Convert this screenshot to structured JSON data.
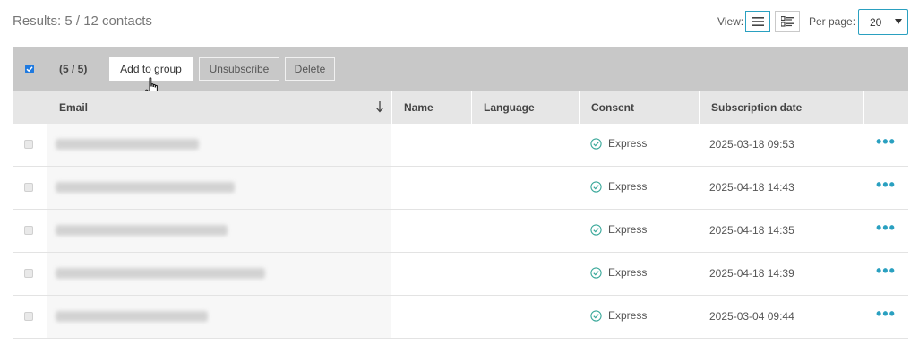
{
  "header": {
    "results_text": "Results: 5 / 12 contacts",
    "view_label": "View:",
    "per_page_label": "Per page:",
    "per_page_value": "20"
  },
  "bulk": {
    "selection_count": "(5 / 5)",
    "add_to_group_label": "Add to group",
    "unsubscribe_label": "Unsubscribe",
    "delete_label": "Delete"
  },
  "table": {
    "columns": [
      "Email",
      "Name",
      "Language",
      "Consent",
      "Subscription date"
    ],
    "rows": [
      {
        "consent": "Express",
        "date": "2025-03-18 09:53"
      },
      {
        "consent": "Express",
        "date": "2025-04-18 14:43"
      },
      {
        "consent": "Express",
        "date": "2025-04-18 14:35"
      },
      {
        "consent": "Express",
        "date": "2025-04-18 14:39"
      },
      {
        "consent": "Express",
        "date": "2025-03-04 09:44"
      }
    ],
    "actions_glyph": "•••"
  },
  "colors": {
    "accent": "#2aa0c0",
    "bulk_bar": "#c8c8c8",
    "header_bg": "#e6e6e6",
    "checkbox_blue": "#1f7ae0"
  }
}
